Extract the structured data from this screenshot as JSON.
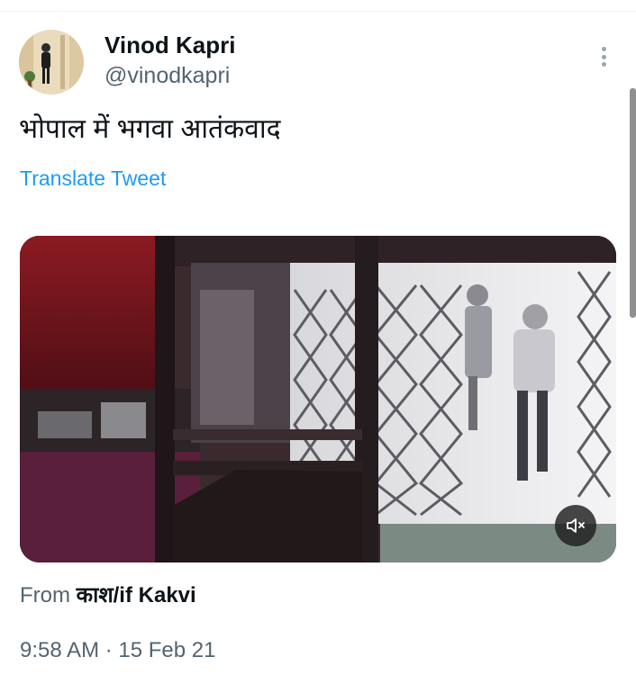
{
  "author": {
    "display_name": "Vinod Kapri",
    "handle": "@vinodkapri"
  },
  "tweet": {
    "text": "भोपाल में भगवा आतंकवाद",
    "translate_label": "Translate Tweet",
    "source_prefix": "From",
    "source_app": "काश/if Kakvi",
    "time": "9:58 AM",
    "separator": "·",
    "date": "15 Feb 21"
  },
  "media": {
    "type": "video",
    "muted": true
  },
  "icons": {
    "more": "more-vertical-icon",
    "mute": "volume-muted-icon"
  },
  "colors": {
    "link": "#1d9bf0",
    "secondary_text": "#536471",
    "primary_text": "#0f1419"
  }
}
